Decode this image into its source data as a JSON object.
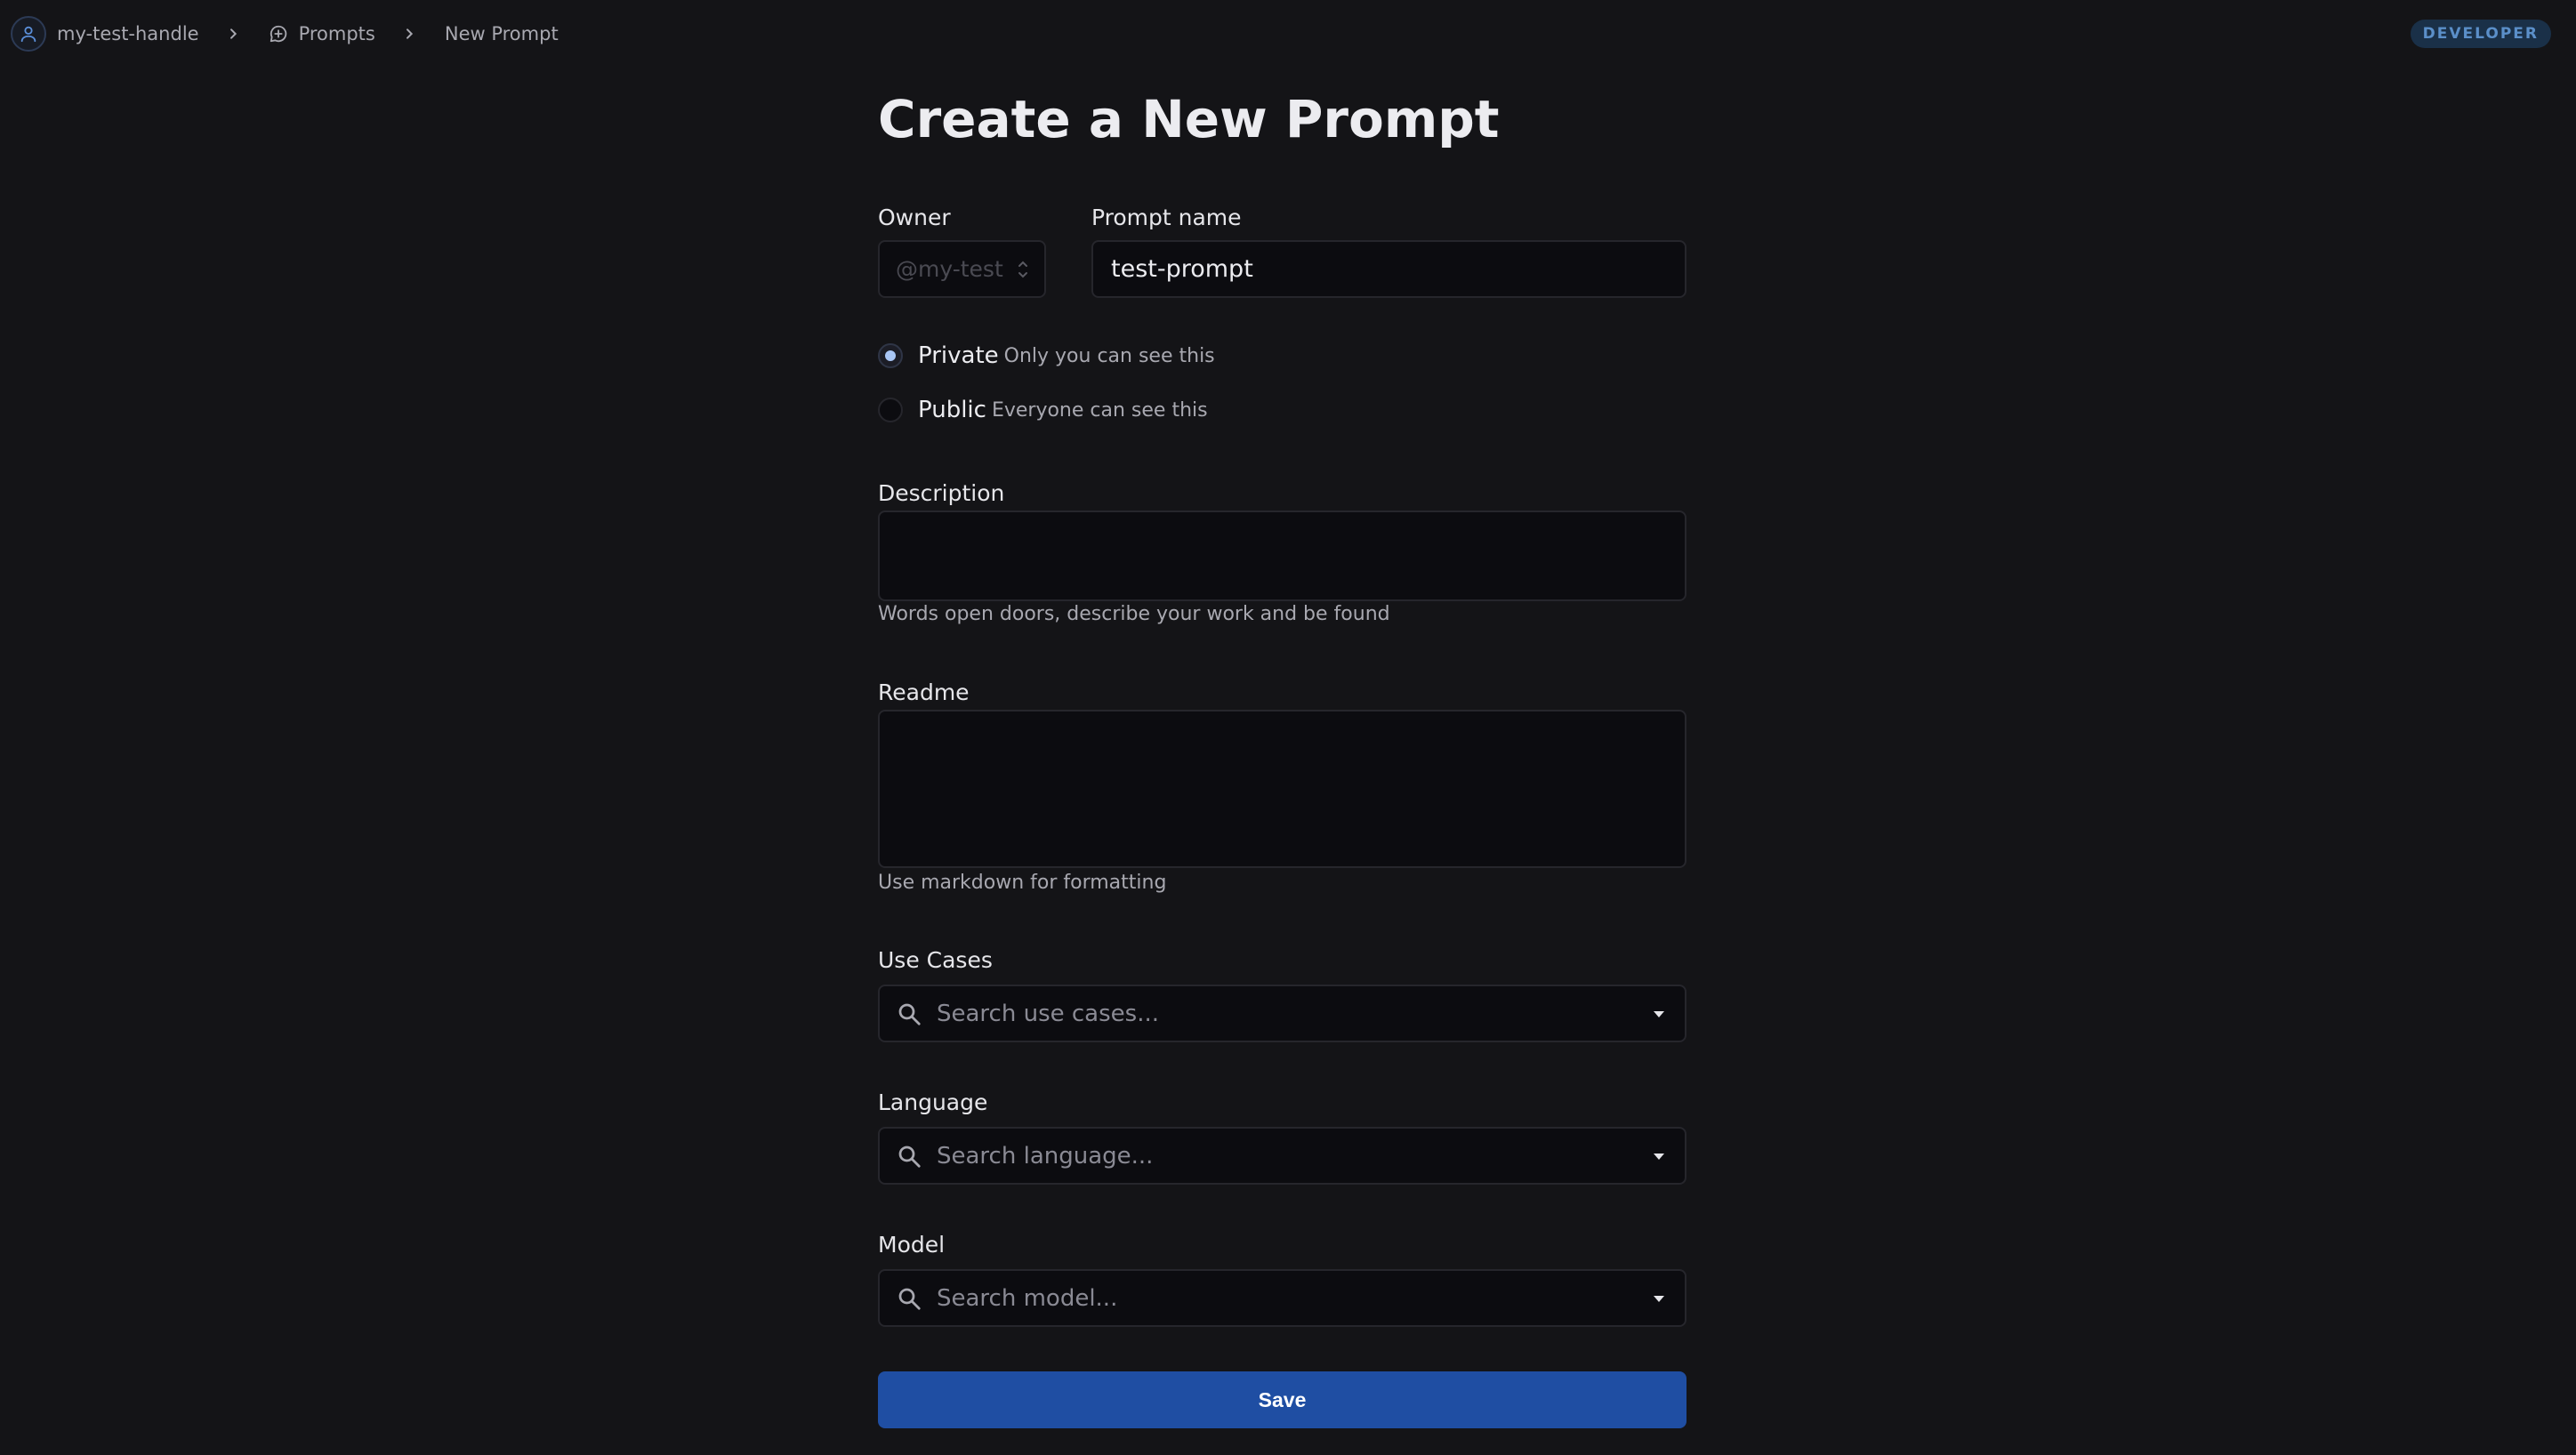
{
  "breadcrumb": {
    "user": "my-test-handle",
    "section": "Prompts",
    "current": "New Prompt"
  },
  "badge": "DEVELOPER",
  "form": {
    "title": "Create a New Prompt",
    "owner": {
      "label": "Owner",
      "value": "@my-test"
    },
    "prompt_name": {
      "label": "Prompt name",
      "value": "test-prompt"
    },
    "visibility": {
      "selected": "Private",
      "options": [
        {
          "label": "Private",
          "hint": "Only you can see this"
        },
        {
          "label": "Public",
          "hint": "Everyone can see this"
        }
      ]
    },
    "description": {
      "label": "Description",
      "value": "",
      "helper": "Words open doors, describe your work and be found"
    },
    "readme": {
      "label": "Readme",
      "value": "",
      "helper": "Use markdown for formatting"
    },
    "use_cases": {
      "label": "Use Cases",
      "placeholder": "Search use cases..."
    },
    "language": {
      "label": "Language",
      "placeholder": "Search language..."
    },
    "model": {
      "label": "Model",
      "placeholder": "Search model..."
    },
    "save_label": "Save"
  },
  "icons": {
    "user": "user-icon",
    "prompts": "chat-bubble-plus-icon",
    "separator": "chevron-right-icon",
    "owner_select": "up-down-chevron-icon",
    "search": "search-icon",
    "dropdown": "caret-down-icon"
  },
  "colors": {
    "background": "#141417",
    "field": "#0c0c10",
    "accent": "#1f4ea3",
    "badge_bg": "#1a3048",
    "badge_text": "#5b8fc9"
  }
}
